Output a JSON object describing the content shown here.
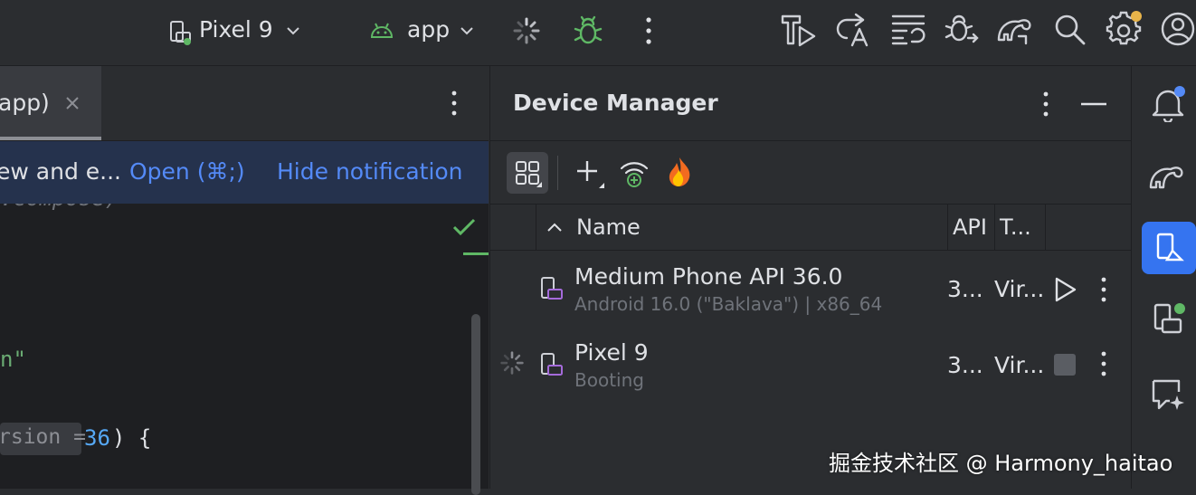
{
  "toolbar": {
    "device_selector": "Pixel 9",
    "run_config": "app"
  },
  "editor": {
    "tab_label": "app)",
    "notification": {
      "message": "ew and e...",
      "open_action": "Open (⌘;)",
      "hide_action": "Hide notification"
    },
    "code_lines": {
      "line1": ".compose)",
      "line2": "n\"",
      "line3_hint": "rsion =",
      "line3_value": "36",
      "line3_rest": ") {"
    }
  },
  "device_manager": {
    "title": "Device Manager",
    "columns": {
      "name": "Name",
      "api": "API",
      "type": "T..."
    },
    "devices": [
      {
        "name": "Medium Phone API 36.0",
        "subtitle": "Android 16.0 (\"Baklava\") | x86_64",
        "api": "3...",
        "type": "Vir..."
      },
      {
        "name": "Pixel 9",
        "subtitle": "Booting",
        "api": "3...",
        "type": "Vir..."
      }
    ]
  },
  "watermark": "掘金技术社区 @ Harmony_haitao",
  "colors": {
    "accent": "#548af7",
    "android_green": "#5fb865",
    "debug_green": "#5fb865",
    "notification_bg": "#25324d",
    "link": "#548af7",
    "check_green": "#5fb865"
  }
}
